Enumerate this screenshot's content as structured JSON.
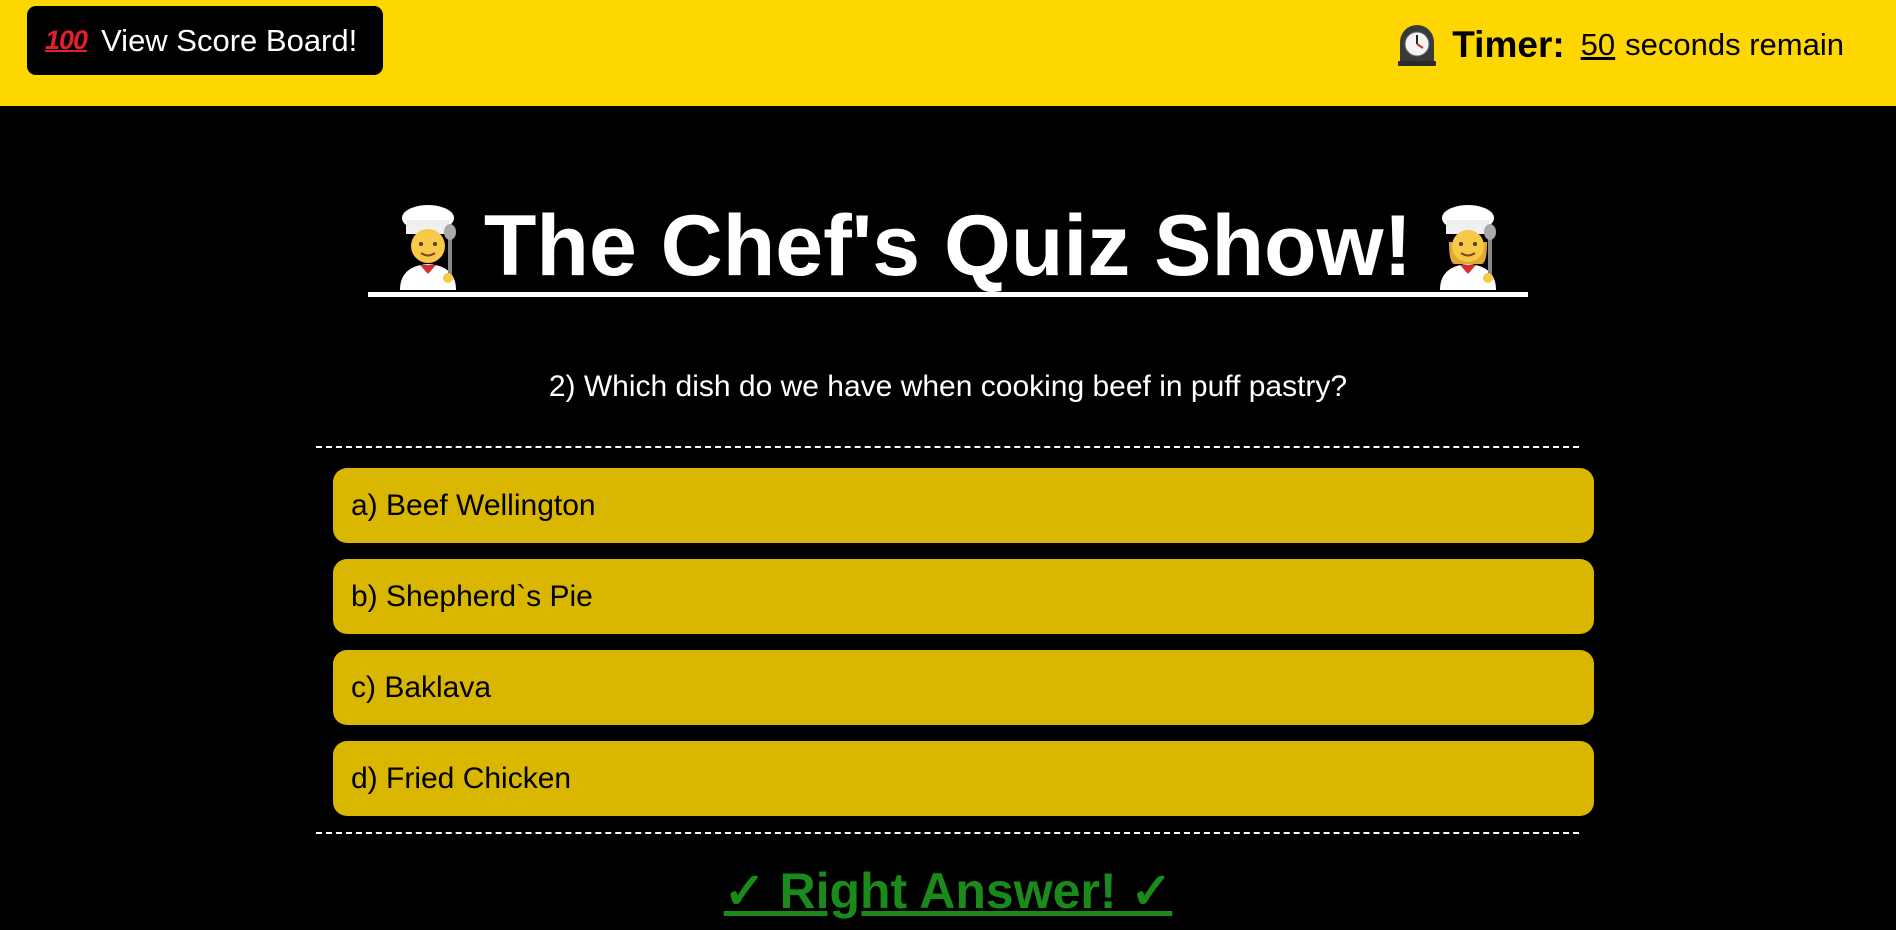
{
  "header": {
    "score_button": {
      "icon": "hundred-points-icon",
      "icon_text": "100",
      "label": "View Score Board!"
    },
    "timer": {
      "icon": "mantelpiece-clock-icon",
      "label": "Timer:",
      "seconds": "50",
      "suffix": "seconds remain"
    }
  },
  "title": {
    "text": "The Chef's Quiz Show!",
    "left_icon": "man-cook-icon",
    "right_icon": "woman-cook-icon"
  },
  "question": {
    "text": "2) Which dish do we have when cooking beef in puff pastry?"
  },
  "answers": [
    {
      "label": "a) Beef Wellington"
    },
    {
      "label": "b) Shepherd`s Pie"
    },
    {
      "label": "c) Baklava"
    },
    {
      "label": "d) Fried Chicken"
    }
  ],
  "result": {
    "text": "✓ Right Answer! ✓"
  },
  "colors": {
    "header_bg": "#FFD700",
    "page_bg": "#000000",
    "answer_bg": "#D9B700",
    "right_answer": "#1a8a1a"
  }
}
